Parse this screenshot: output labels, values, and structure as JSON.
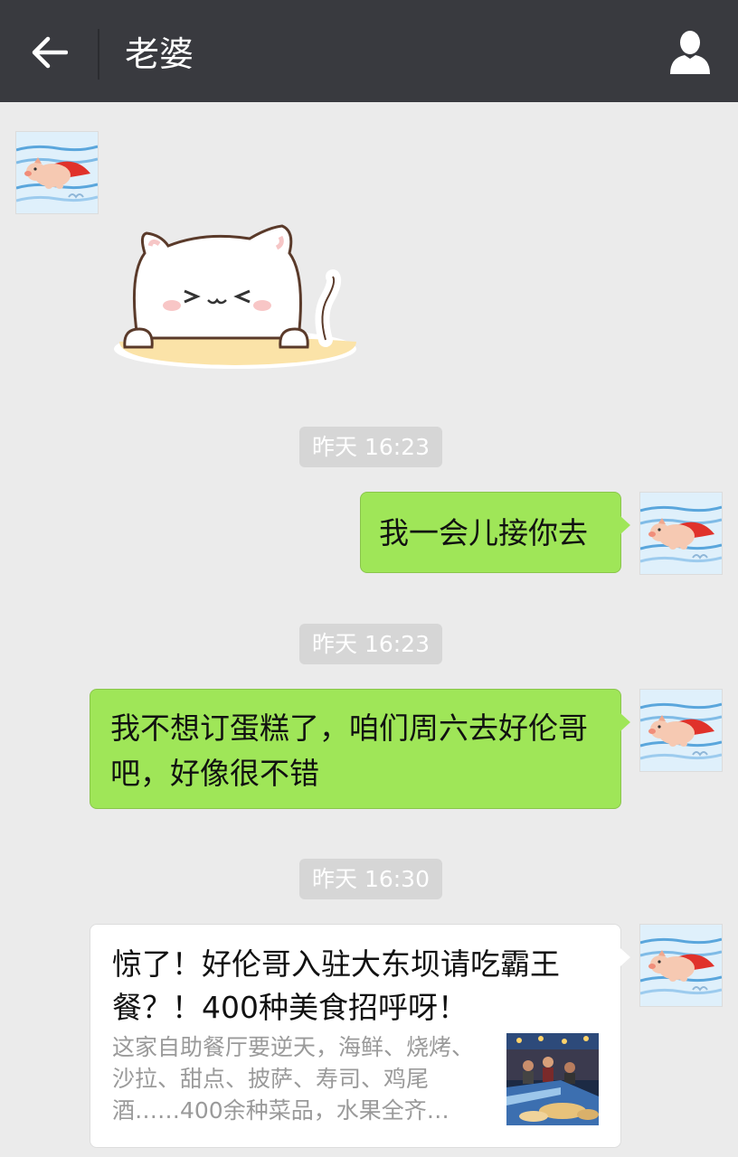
{
  "header": {
    "title": "老婆",
    "back_icon": "arrow-left-icon",
    "profile_icon": "person-icon",
    "background": "#393a3f"
  },
  "messages": [
    {
      "type": "sticker",
      "side": "left",
      "avatar_icon": "flying-pig-avatar",
      "sticker_icon": "cat-sticker"
    },
    {
      "type": "time",
      "text": "昨天 16:23"
    },
    {
      "type": "text",
      "side": "right",
      "text": "我一会儿接你去"
    },
    {
      "type": "time",
      "text": "昨天 16:23"
    },
    {
      "type": "text",
      "side": "right",
      "text": "我不想订蛋糕了，咱们周六去好伦哥吧，好像很不错"
    },
    {
      "type": "time",
      "text": "昨天 16:30"
    },
    {
      "type": "link",
      "side": "right",
      "title": "惊了！好伦哥入驻大东坝请吃霸王餐？！400种美食招呼呀！",
      "description": "这家自助餐厅要逆天，海鲜、烧烤、沙拉、甜点、披萨、寿司、鸡尾酒……400余种菜品，水果全齐…",
      "thumbnail_icon": "buffet-photo"
    }
  ],
  "colors": {
    "chat_background": "#ebebeb",
    "sent_bubble": "#9fe658",
    "time_chip": "#d6d6d6"
  }
}
